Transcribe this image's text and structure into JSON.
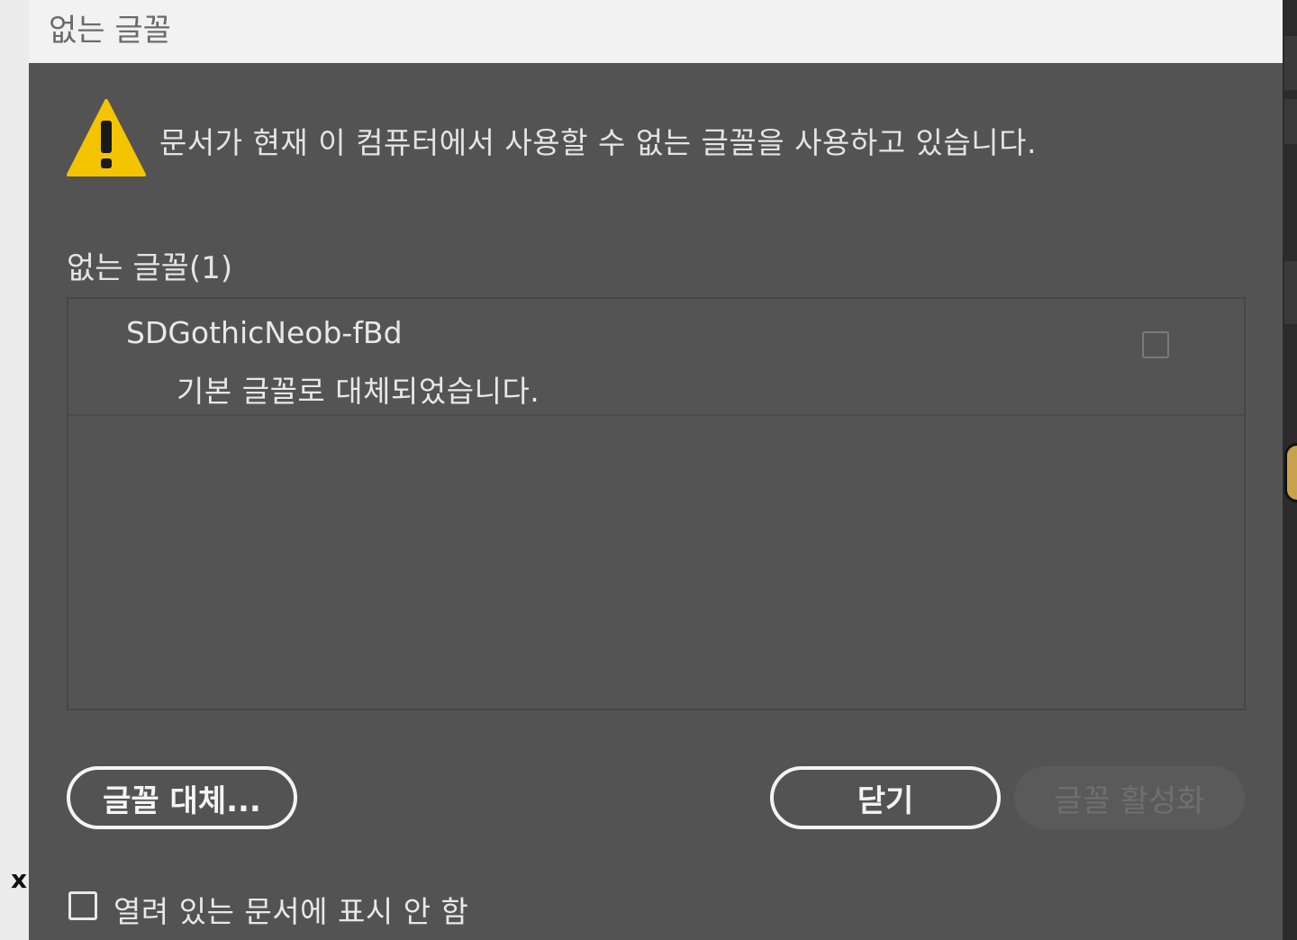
{
  "dialog": {
    "title": "없는 글꼴",
    "warning_message": "문서가 현재 이 컴퓨터에서 사용할 수 없는 글꼴을 사용하고 있습니다.",
    "missing_fonts_label": "없는 글꼴(1)",
    "fonts": [
      {
        "name": "SDGothicNeob-fBd",
        "status": "기본 글꼴로 대체되었습니다.",
        "checked": false
      }
    ],
    "buttons": {
      "replace": "글꼴 대체...",
      "close": "닫기",
      "activate": "글꼴 활성화"
    },
    "dont_show_label": "열려 있는 문서에 표시 안 함",
    "dont_show_checked": false
  },
  "colors": {
    "dialog_bg": "#535353",
    "titlebar_bg": "#f2f2f2",
    "warning_yellow": "#f5c400",
    "text": "#e4e4e4",
    "disabled_text": "#6f6f6f"
  },
  "icons": {
    "warning": "warning-triangle-icon"
  }
}
